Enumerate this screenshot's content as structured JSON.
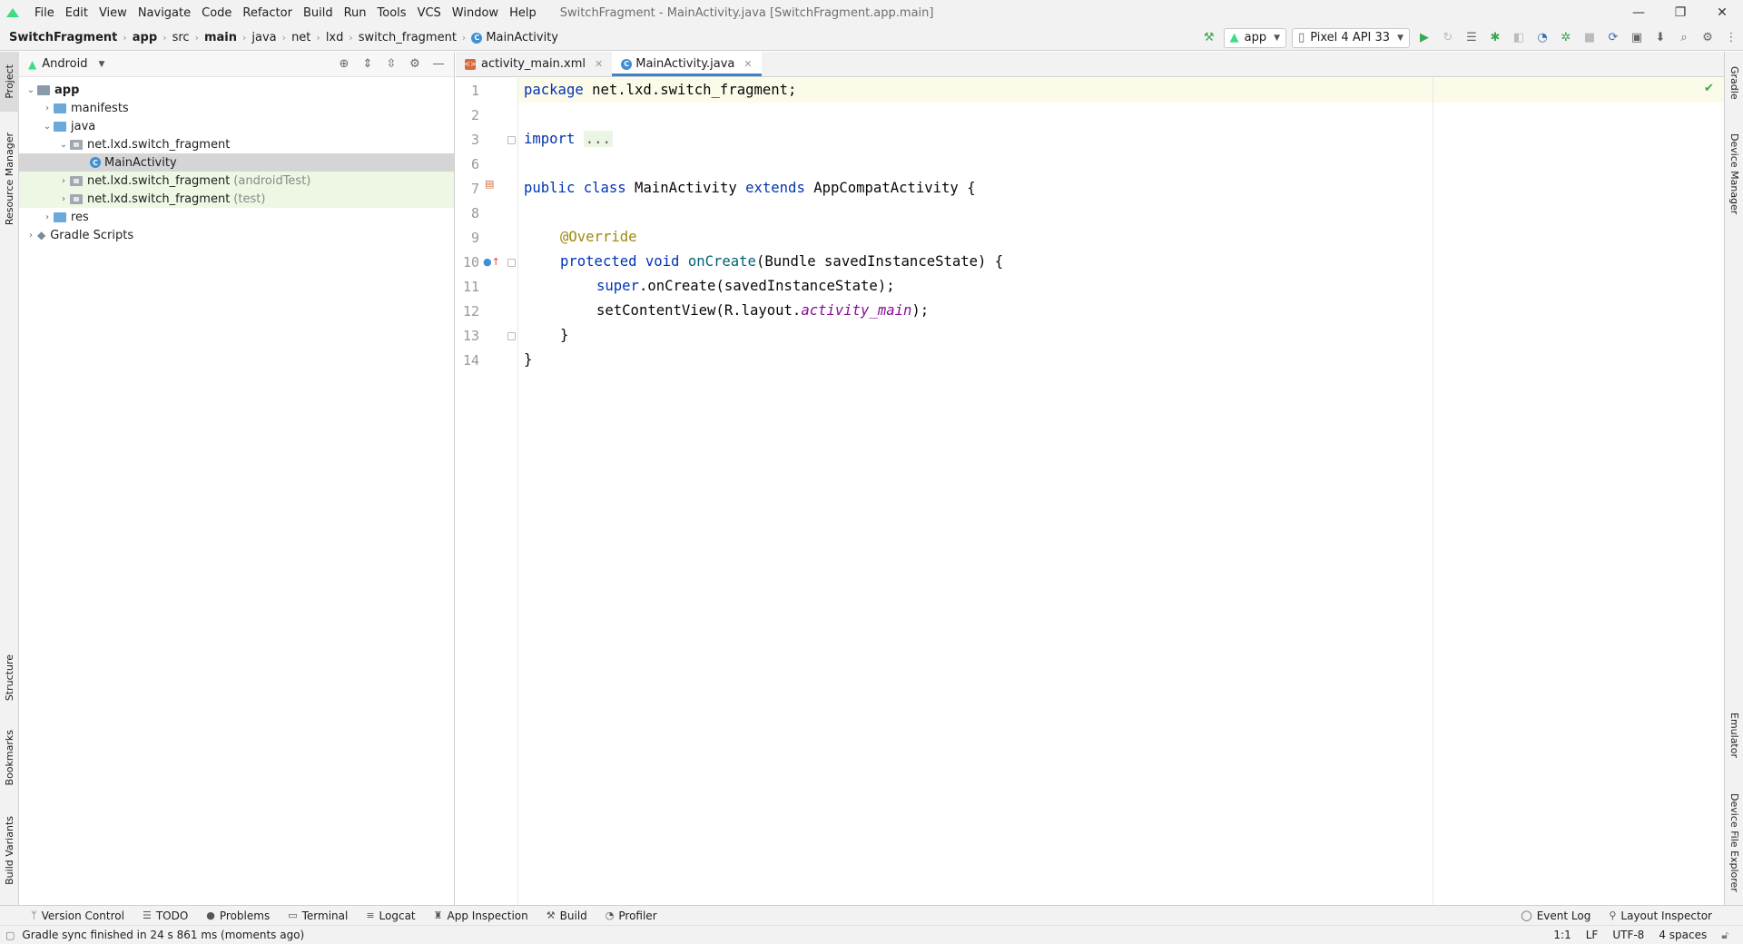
{
  "window": {
    "title": "SwitchFragment - MainActivity.java [SwitchFragment.app.main]",
    "controls": [
      "—",
      "❐",
      "✕"
    ]
  },
  "menu": [
    "File",
    "Edit",
    "View",
    "Navigate",
    "Code",
    "Refactor",
    "Build",
    "Run",
    "Tools",
    "VCS",
    "Window",
    "Help"
  ],
  "breadcrumb": [
    "SwitchFragment",
    "app",
    "src",
    "main",
    "java",
    "net",
    "lxd",
    "switch_fragment",
    "MainActivity"
  ],
  "toolbar": {
    "run_config": "app",
    "device": "Pixel 4 API 33"
  },
  "left_stripe": {
    "project": "Project",
    "resource_manager": "Resource Manager",
    "structure": "Structure",
    "bookmarks": "Bookmarks",
    "build_variants": "Build Variants"
  },
  "right_stripe": {
    "gradle": "Gradle",
    "device_manager": "Device Manager",
    "emulator": "Emulator",
    "device_file_explorer": "Device File Explorer"
  },
  "project_panel": {
    "view": "Android",
    "tree": [
      {
        "label": "app",
        "suffix": ""
      },
      {
        "label": "manifests",
        "suffix": ""
      },
      {
        "label": "java",
        "suffix": ""
      },
      {
        "label": "net.lxd.switch_fragment",
        "suffix": ""
      },
      {
        "label": "MainActivity",
        "suffix": ""
      },
      {
        "label": "net.lxd.switch_fragment",
        "suffix": "(androidTest)"
      },
      {
        "label": "net.lxd.switch_fragment",
        "suffix": "(test)"
      },
      {
        "label": "res",
        "suffix": ""
      },
      {
        "label": "Gradle Scripts",
        "suffix": ""
      }
    ]
  },
  "editor": {
    "tabs": [
      {
        "label": "activity_main.xml"
      },
      {
        "label": "MainActivity.java"
      }
    ],
    "line_numbers": [
      "1",
      "2",
      "3",
      "6",
      "7",
      "8",
      "9",
      "10",
      "11",
      "12",
      "13",
      "14"
    ],
    "code": {
      "l1_kw": "package",
      "l1_rest": " net.lxd.switch_fragment;",
      "l3_kw": "import",
      "l3_dots": "...",
      "l7_kw1": "public class",
      "l7_name": " MainActivity ",
      "l7_kw2": "extends",
      "l7_rest": " AppCompatActivity {",
      "l9_ann": "@Override",
      "l10_kw": "protected void",
      "l10_fn": " onCreate",
      "l10_rest": "(Bundle savedInstanceState) {",
      "l11_kw": "super",
      "l11_rest": ".onCreate(savedInstanceState);",
      "l12_a": "setContentView(R.layout.",
      "l12_it": "activity_main",
      "l12_b": ");",
      "l13": "}",
      "l14": "}"
    }
  },
  "bottom_tools": [
    "Version Control",
    "TODO",
    "Problems",
    "Terminal",
    "Logcat",
    "App Inspection",
    "Build",
    "Profiler"
  ],
  "bottom_tools_right": [
    "Event Log",
    "Layout Inspector"
  ],
  "status": {
    "message": "Gradle sync finished in 24 s 861 ms (moments ago)",
    "position": "1:1",
    "line_sep": "LF",
    "encoding": "UTF-8",
    "indent": "4 spaces"
  },
  "colors": {
    "keyword": "#0033b3",
    "annotation": "#9e880d",
    "function": "#00627a",
    "italic_field": "#871094",
    "tab_accent": "#4083c9"
  }
}
